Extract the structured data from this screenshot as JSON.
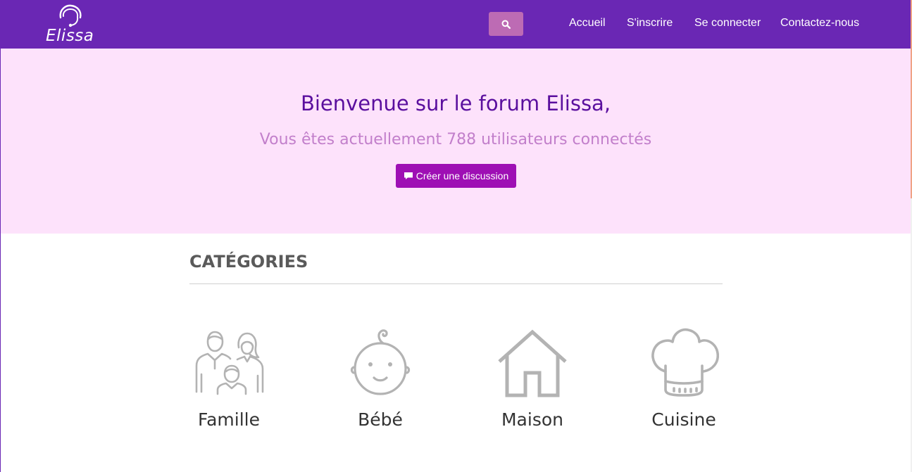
{
  "header": {
    "brand": "Elissa",
    "nav": [
      {
        "label": "Accueil"
      },
      {
        "label": "S'inscrire"
      },
      {
        "label": "Se connecter"
      },
      {
        "label": "Contactez-nous"
      }
    ]
  },
  "hero": {
    "title": "Bienvenue sur le forum Elissa,",
    "subtitle": "Vous êtes actuellement 788 utilisateurs connectés",
    "cta_label": "Créer une discussion"
  },
  "categories": {
    "heading": "CATÉGORIES",
    "items": [
      {
        "label": "Famille",
        "icon": "family-icon"
      },
      {
        "label": "Bébé",
        "icon": "baby-icon"
      },
      {
        "label": "Maison",
        "icon": "house-icon"
      },
      {
        "label": "Cuisine",
        "icon": "chef-hat-icon"
      }
    ]
  },
  "colors": {
    "navbar": "#6a27b4",
    "hero_bg": "#fde2fb",
    "title": "#5a0f9e",
    "subtitle": "#c27fcb",
    "cta": "#9e0fb4",
    "search_button": "#bd6bb4",
    "icon_gray": "#b3b3b3"
  }
}
